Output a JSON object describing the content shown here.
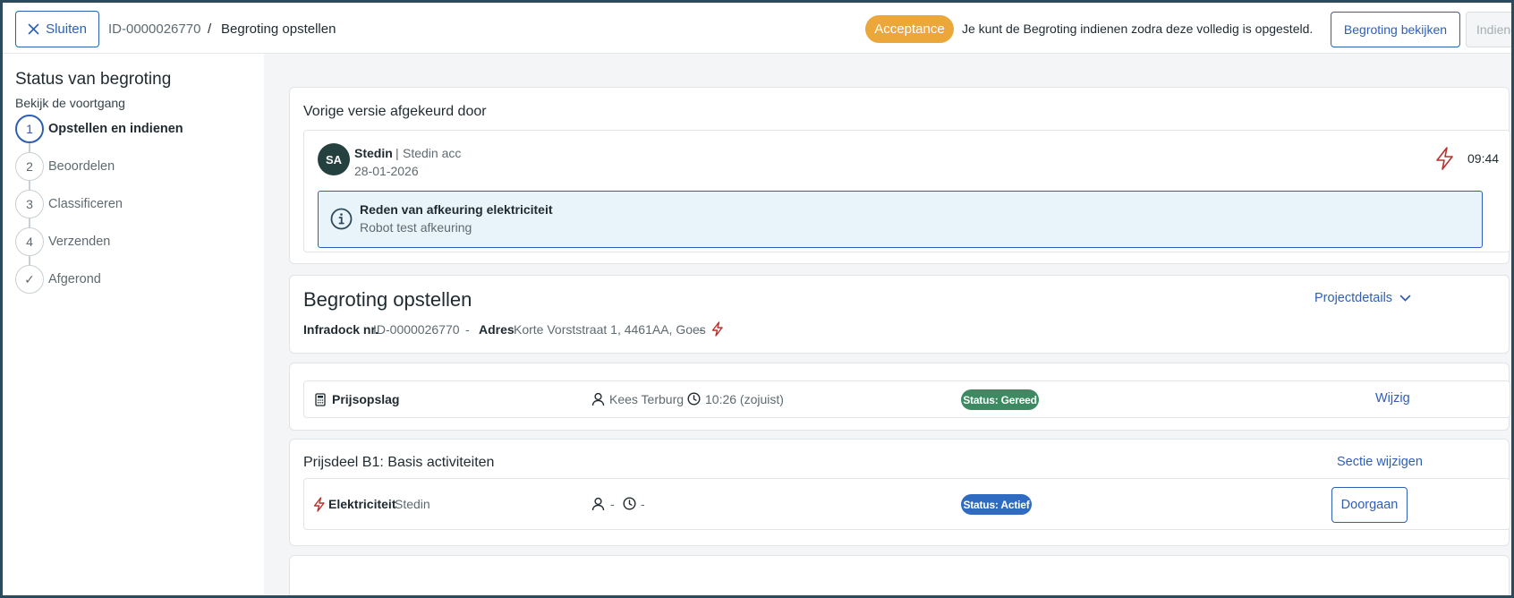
{
  "header": {
    "close_label": "Sluiten",
    "breadcrumb_id": "ID-0000026770",
    "breadcrumb_sep": "/",
    "breadcrumb_title": "Begroting opstellen",
    "status_pill": "Acceptance",
    "hint": "Je kunt de Begroting indienen zodra deze volledig is opgesteld.",
    "view_label": "Begroting bekijken",
    "submit_label": "Indienen"
  },
  "sidebar": {
    "title": "Status van begroting",
    "subtitle": "Bekijk de voortgang",
    "steps": [
      {
        "num": "1",
        "label": "Opstellen en indienen"
      },
      {
        "num": "2",
        "label": "Beoordelen"
      },
      {
        "num": "3",
        "label": "Classificeren"
      },
      {
        "num": "4",
        "label": "Verzenden"
      },
      {
        "num": "✓",
        "label": "Afgerond"
      }
    ]
  },
  "rejection": {
    "title": "Vorige versie afgekeurd door",
    "avatar": "SA",
    "org": "Stedin",
    "org_sep": "|",
    "user": "Stedin acc",
    "date": "28-01-2026",
    "time": "09:44",
    "reason_title": "Reden van afkeuring elektriciteit",
    "reason_text": "Robot test afkeuring"
  },
  "budget": {
    "title": "Begroting opstellen",
    "project_link": "Projectdetails",
    "infradock_label": "Infradock nr.",
    "infradock_value": "ID-0000026770",
    "dash": "-",
    "address_label": "Adres",
    "address_value": "Korte Vorststraat 1, 4461AA, Goes"
  },
  "markup_row": {
    "label": "Prijsopslag",
    "user": "Kees Terburg",
    "time": "10:26 (zojuist)",
    "status": "Status: Gereed",
    "action": "Wijzig"
  },
  "section_b1": {
    "title": "Prijsdeel B1: Basis activiteiten",
    "edit_link": "Sectie wijzigen",
    "row_label": "Elektriciteit",
    "row_org": "Stedin",
    "row_user": "-",
    "row_time": "-",
    "status": "Status: Actief",
    "action": "Doorgaan"
  },
  "colors": {
    "accent": "#2f5fb5",
    "pill": "#eca73a",
    "status_ready": "#3d8a62",
    "status_active": "#2f6bc0",
    "bolt": "#b8302c"
  }
}
